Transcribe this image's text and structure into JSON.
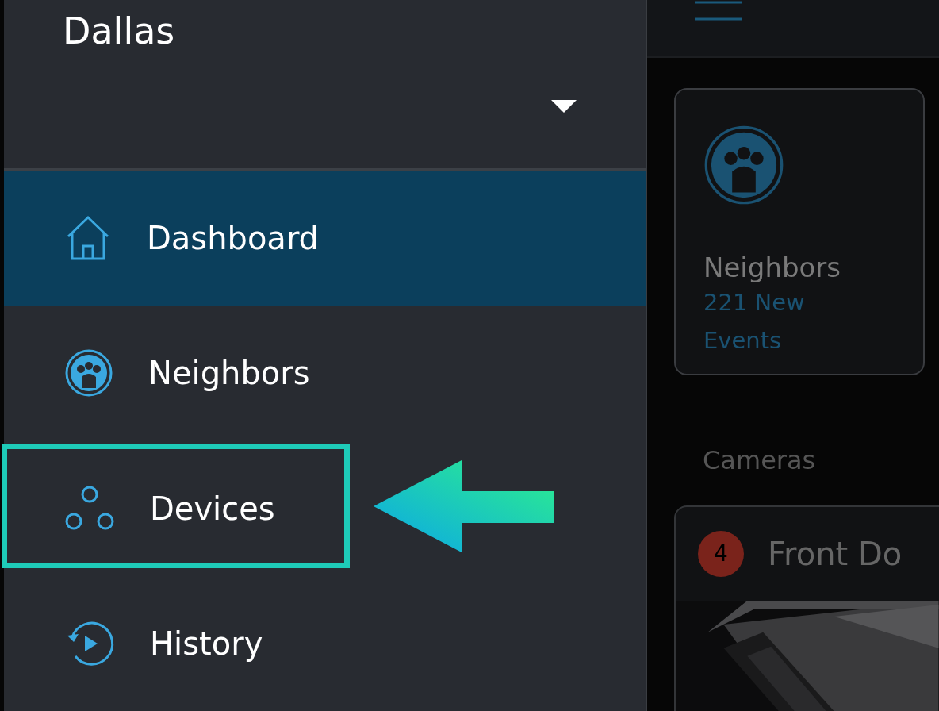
{
  "sidebar": {
    "location": "Dallas",
    "items": [
      {
        "label": "Dashboard",
        "kind": "home",
        "selected": true,
        "highlighted": false
      },
      {
        "label": "Neighbors",
        "kind": "neighbors",
        "selected": false,
        "highlighted": false
      },
      {
        "label": "Devices",
        "kind": "devices",
        "selected": false,
        "highlighted": true
      },
      {
        "label": "History",
        "kind": "history",
        "selected": false,
        "highlighted": false
      }
    ]
  },
  "main": {
    "neighbors_card": {
      "title": "Neighbors",
      "subtitle": "221 New Events"
    },
    "section_title": "Cameras",
    "camera": {
      "name": "Front Do",
      "badge": "4"
    }
  }
}
